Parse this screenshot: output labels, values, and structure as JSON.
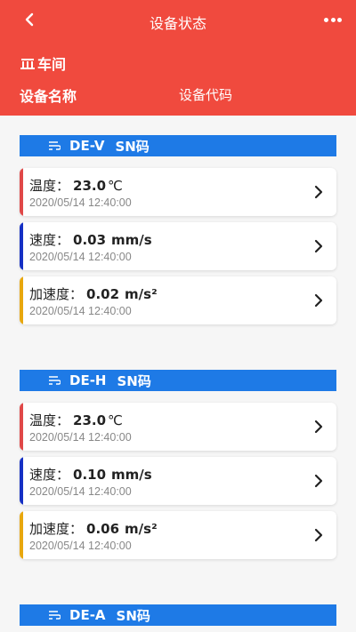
{
  "nav": {
    "title": "设备状态",
    "back_icon": "chevron-left-icon",
    "more_icon": "more-dots-icon"
  },
  "header": {
    "workshop_icon": "factory-icon",
    "workshop_label": "车间",
    "device_name_label": "设备名称",
    "device_code_label": "设备代码"
  },
  "colors": {
    "header_bg": "#f04a3e",
    "group_bg": "#1e7ae6",
    "temperature": "#e04848",
    "speed": "#1530c4",
    "acceleration": "#e8a70d"
  },
  "groups": [
    {
      "name": "DE-V",
      "code": "SN码",
      "icon": "list-icon",
      "items": [
        {
          "label": "温度：",
          "value": "23.0",
          "unit": "℃",
          "time": "2020/05/14 12:40:00"
        },
        {
          "label": "速度：",
          "value": "0.03",
          "unit": "mm/s",
          "time": "2020/05/14 12:40:00"
        },
        {
          "label": "加速度：",
          "value": "0.02",
          "unit": "m/s²",
          "time": "2020/05/14 12:40:00"
        }
      ]
    },
    {
      "name": "DE-H",
      "code": "SN码",
      "icon": "list-icon",
      "items": [
        {
          "label": "温度：",
          "value": "23.0",
          "unit": "℃",
          "time": "2020/05/14 12:40:00"
        },
        {
          "label": "速度：",
          "value": "0.10",
          "unit": "mm/s",
          "time": "2020/05/14 12:40:00"
        },
        {
          "label": "加速度：",
          "value": "0.06",
          "unit": "m/s²",
          "time": "2020/05/14 12:40:00"
        }
      ]
    },
    {
      "name": "DE-A",
      "code": "SN码",
      "icon": "list-icon",
      "items": []
    }
  ]
}
